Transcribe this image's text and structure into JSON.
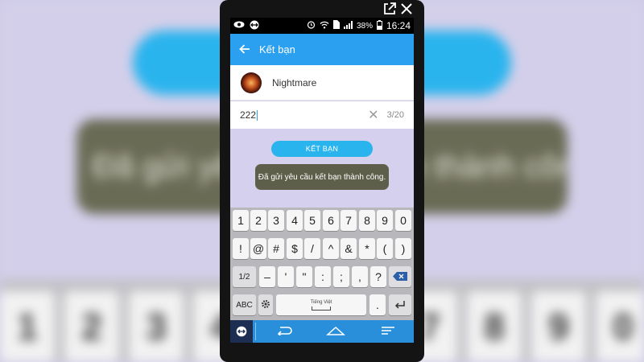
{
  "background": {
    "toast_text": "Đã gửi yêu cầu kết bạn thành công.",
    "keys": [
      "1",
      "2",
      "3",
      "4",
      "7",
      "8",
      "9",
      "0"
    ]
  },
  "overlay": {
    "popout_icon": "external-link-icon",
    "close_icon": "close-icon"
  },
  "status_bar": {
    "icons": [
      "eye-icon",
      "teamviewer-icon",
      "alarm-icon",
      "wifi-icon",
      "sim-icon",
      "signal-icon"
    ],
    "battery": "38%",
    "time": "16:24"
  },
  "app_bar": {
    "back_icon": "back-arrow-icon",
    "title": "Kết bạn"
  },
  "contact": {
    "name": "Nightmare"
  },
  "message_field": {
    "value": "222",
    "counter": "3/20"
  },
  "add_friend_button": "KẾT BẠN",
  "toast": "Đã gửi yêu cầu kết bạn thành công.",
  "keyboard": {
    "row1": [
      "1",
      "2",
      "3",
      "4",
      "5",
      "6",
      "7",
      "8",
      "9",
      "0"
    ],
    "row2": [
      "!",
      "@",
      "#",
      "$",
      "/",
      "^",
      "&",
      "*",
      "(",
      ")"
    ],
    "row3": [
      "1/2",
      "–",
      "'",
      "\"",
      ":",
      ";",
      ",",
      "?"
    ],
    "abc": "ABC",
    "language": "Tiếng Việt",
    "period": "."
  },
  "nav_bar": {
    "icons": [
      "teamviewer-icon",
      "back-icon",
      "home-icon",
      "recent-apps-icon"
    ]
  },
  "colors": {
    "app_bar": "#2b9ff0",
    "button": "#2ab4ee",
    "toast": "#5e5f4a",
    "screen_bg": "#d5d0ee"
  }
}
